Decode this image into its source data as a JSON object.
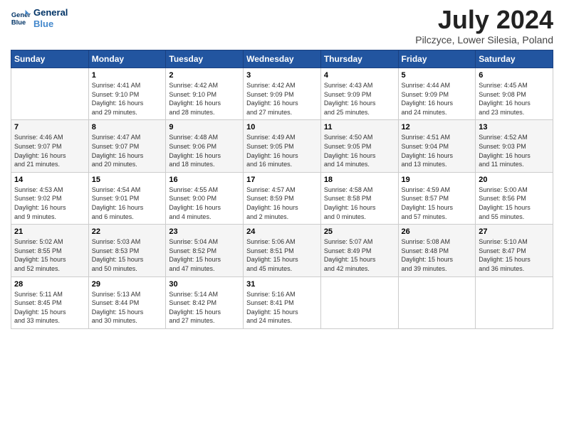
{
  "header": {
    "logo_line1": "General",
    "logo_line2": "Blue",
    "month": "July 2024",
    "location": "Pilczyce, Lower Silesia, Poland"
  },
  "columns": [
    "Sunday",
    "Monday",
    "Tuesday",
    "Wednesday",
    "Thursday",
    "Friday",
    "Saturday"
  ],
  "weeks": [
    [
      {
        "day": "",
        "info": ""
      },
      {
        "day": "1",
        "info": "Sunrise: 4:41 AM\nSunset: 9:10 PM\nDaylight: 16 hours\nand 29 minutes."
      },
      {
        "day": "2",
        "info": "Sunrise: 4:42 AM\nSunset: 9:10 PM\nDaylight: 16 hours\nand 28 minutes."
      },
      {
        "day": "3",
        "info": "Sunrise: 4:42 AM\nSunset: 9:09 PM\nDaylight: 16 hours\nand 27 minutes."
      },
      {
        "day": "4",
        "info": "Sunrise: 4:43 AM\nSunset: 9:09 PM\nDaylight: 16 hours\nand 25 minutes."
      },
      {
        "day": "5",
        "info": "Sunrise: 4:44 AM\nSunset: 9:09 PM\nDaylight: 16 hours\nand 24 minutes."
      },
      {
        "day": "6",
        "info": "Sunrise: 4:45 AM\nSunset: 9:08 PM\nDaylight: 16 hours\nand 23 minutes."
      }
    ],
    [
      {
        "day": "7",
        "info": "Sunrise: 4:46 AM\nSunset: 9:07 PM\nDaylight: 16 hours\nand 21 minutes."
      },
      {
        "day": "8",
        "info": "Sunrise: 4:47 AM\nSunset: 9:07 PM\nDaylight: 16 hours\nand 20 minutes."
      },
      {
        "day": "9",
        "info": "Sunrise: 4:48 AM\nSunset: 9:06 PM\nDaylight: 16 hours\nand 18 minutes."
      },
      {
        "day": "10",
        "info": "Sunrise: 4:49 AM\nSunset: 9:05 PM\nDaylight: 16 hours\nand 16 minutes."
      },
      {
        "day": "11",
        "info": "Sunrise: 4:50 AM\nSunset: 9:05 PM\nDaylight: 16 hours\nand 14 minutes."
      },
      {
        "day": "12",
        "info": "Sunrise: 4:51 AM\nSunset: 9:04 PM\nDaylight: 16 hours\nand 13 minutes."
      },
      {
        "day": "13",
        "info": "Sunrise: 4:52 AM\nSunset: 9:03 PM\nDaylight: 16 hours\nand 11 minutes."
      }
    ],
    [
      {
        "day": "14",
        "info": "Sunrise: 4:53 AM\nSunset: 9:02 PM\nDaylight: 16 hours\nand 9 minutes."
      },
      {
        "day": "15",
        "info": "Sunrise: 4:54 AM\nSunset: 9:01 PM\nDaylight: 16 hours\nand 6 minutes."
      },
      {
        "day": "16",
        "info": "Sunrise: 4:55 AM\nSunset: 9:00 PM\nDaylight: 16 hours\nand 4 minutes."
      },
      {
        "day": "17",
        "info": "Sunrise: 4:57 AM\nSunset: 8:59 PM\nDaylight: 16 hours\nand 2 minutes."
      },
      {
        "day": "18",
        "info": "Sunrise: 4:58 AM\nSunset: 8:58 PM\nDaylight: 16 hours\nand 0 minutes."
      },
      {
        "day": "19",
        "info": "Sunrise: 4:59 AM\nSunset: 8:57 PM\nDaylight: 15 hours\nand 57 minutes."
      },
      {
        "day": "20",
        "info": "Sunrise: 5:00 AM\nSunset: 8:56 PM\nDaylight: 15 hours\nand 55 minutes."
      }
    ],
    [
      {
        "day": "21",
        "info": "Sunrise: 5:02 AM\nSunset: 8:55 PM\nDaylight: 15 hours\nand 52 minutes."
      },
      {
        "day": "22",
        "info": "Sunrise: 5:03 AM\nSunset: 8:53 PM\nDaylight: 15 hours\nand 50 minutes."
      },
      {
        "day": "23",
        "info": "Sunrise: 5:04 AM\nSunset: 8:52 PM\nDaylight: 15 hours\nand 47 minutes."
      },
      {
        "day": "24",
        "info": "Sunrise: 5:06 AM\nSunset: 8:51 PM\nDaylight: 15 hours\nand 45 minutes."
      },
      {
        "day": "25",
        "info": "Sunrise: 5:07 AM\nSunset: 8:49 PM\nDaylight: 15 hours\nand 42 minutes."
      },
      {
        "day": "26",
        "info": "Sunrise: 5:08 AM\nSunset: 8:48 PM\nDaylight: 15 hours\nand 39 minutes."
      },
      {
        "day": "27",
        "info": "Sunrise: 5:10 AM\nSunset: 8:47 PM\nDaylight: 15 hours\nand 36 minutes."
      }
    ],
    [
      {
        "day": "28",
        "info": "Sunrise: 5:11 AM\nSunset: 8:45 PM\nDaylight: 15 hours\nand 33 minutes."
      },
      {
        "day": "29",
        "info": "Sunrise: 5:13 AM\nSunset: 8:44 PM\nDaylight: 15 hours\nand 30 minutes."
      },
      {
        "day": "30",
        "info": "Sunrise: 5:14 AM\nSunset: 8:42 PM\nDaylight: 15 hours\nand 27 minutes."
      },
      {
        "day": "31",
        "info": "Sunrise: 5:16 AM\nSunset: 8:41 PM\nDaylight: 15 hours\nand 24 minutes."
      },
      {
        "day": "",
        "info": ""
      },
      {
        "day": "",
        "info": ""
      },
      {
        "day": "",
        "info": ""
      }
    ]
  ]
}
